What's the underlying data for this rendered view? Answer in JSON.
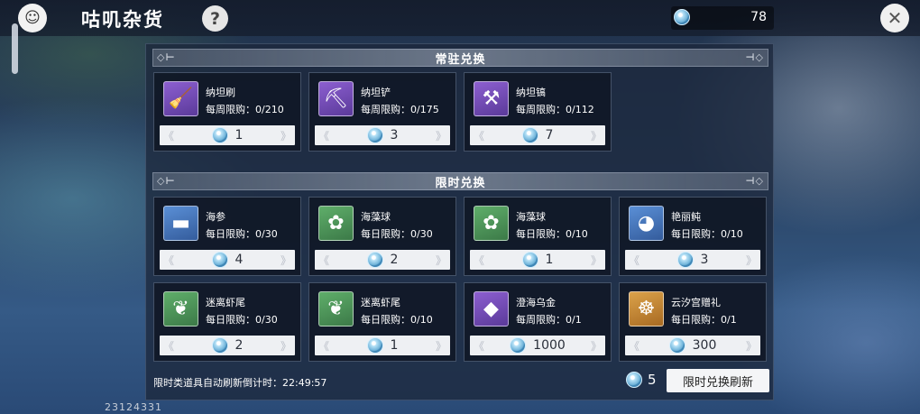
{
  "header": {
    "title": "咕叽杂货",
    "help_symbol": "?",
    "currency_amount": "78",
    "close_symbol": "✕"
  },
  "permanent_section": {
    "title": "常驻兑换",
    "items": [
      {
        "name": "纳坦刷",
        "limit": "每周限购：0/210",
        "price": "1",
        "icon": "brush-icon",
        "color": "purple"
      },
      {
        "name": "纳坦铲",
        "limit": "每周限购：0/175",
        "price": "3",
        "icon": "shovel-icon",
        "color": "purple"
      },
      {
        "name": "纳坦镐",
        "limit": "每周限购：0/112",
        "price": "7",
        "icon": "pickaxe-icon",
        "color": "purple"
      }
    ]
  },
  "limited_section": {
    "title": "限时兑换",
    "items": [
      {
        "name": "海参",
        "limit": "每日限购：0/30",
        "price": "4",
        "icon": "sea-cucumber-icon",
        "color": "blue"
      },
      {
        "name": "海藻球",
        "limit": "每日限购：0/30",
        "price": "2",
        "icon": "seaweed-ball-icon",
        "color": "green"
      },
      {
        "name": "海藻球",
        "limit": "每日限购：0/10",
        "price": "1",
        "icon": "seaweed-ball-icon",
        "color": "green"
      },
      {
        "name": "艳丽鲀",
        "limit": "每日限购：0/10",
        "price": "3",
        "icon": "pufferfish-icon",
        "color": "blue"
      },
      {
        "name": "迷离虾尾",
        "limit": "每日限购：0/30",
        "price": "2",
        "icon": "shrimp-tail-icon",
        "color": "green"
      },
      {
        "name": "迷离虾尾",
        "limit": "每日限购：0/10",
        "price": "1",
        "icon": "shrimp-tail-icon",
        "color": "green"
      },
      {
        "name": "澄海乌金",
        "limit": "每周限购：0/1",
        "price": "1000",
        "icon": "dark-crystal-icon",
        "color": "purple"
      },
      {
        "name": "云汐宫赠礼",
        "limit": "每日限购：0/1",
        "price": "300",
        "icon": "conch-gift-icon",
        "color": "orange"
      }
    ]
  },
  "footer": {
    "countdown_text": "限时类道具自动刷新倒计时：22:49:57",
    "refresh_cost": "5",
    "refresh_button": "限时兑换刷新"
  },
  "uid": "23124331"
}
